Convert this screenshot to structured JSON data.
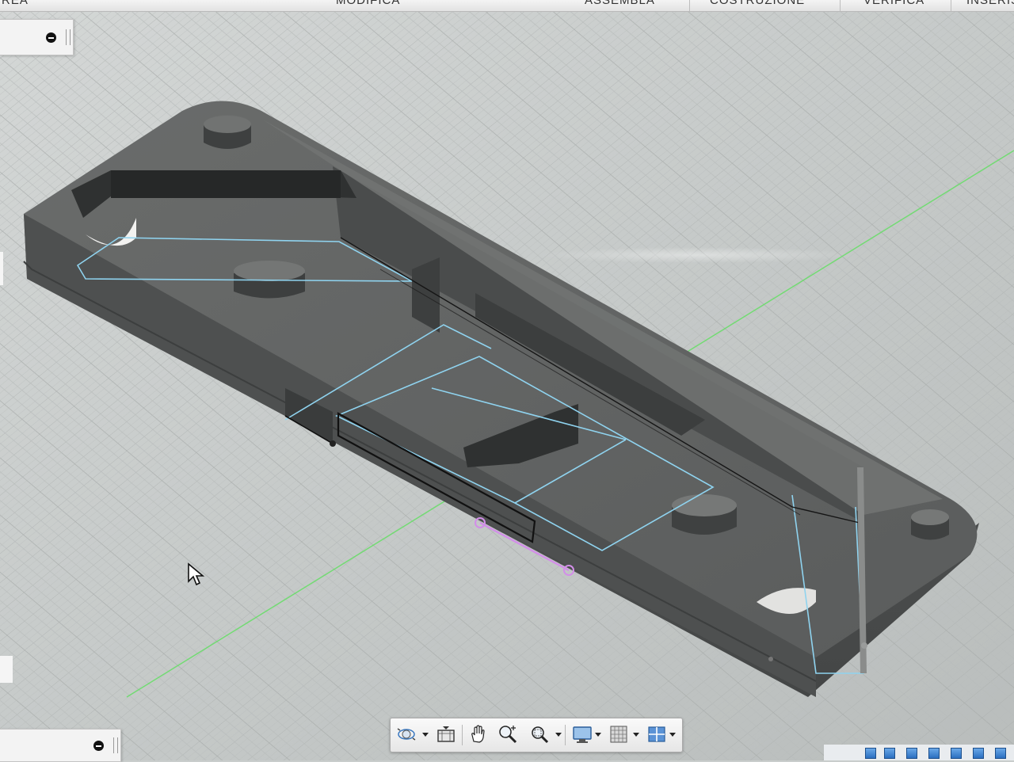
{
  "toolbar": {
    "tabs": [
      {
        "label": "REA"
      },
      {
        "label": "MODIFICA"
      },
      {
        "label": "ASSEMBLA"
      },
      {
        "label": "COSTRUZIONE"
      },
      {
        "label": "VERIFICA"
      },
      {
        "label": "INSERIS"
      }
    ]
  },
  "icons": {
    "browser_toggle": "minus-circle-icon",
    "comments_toggle": "minus-circle-icon",
    "orbit": "orbit-icon",
    "look_at": "look-at-icon",
    "pan": "pan-hand-icon",
    "zoom": "zoom-icon",
    "zoom_window": "zoom-window-icon",
    "display_settings": "display-settings-icon",
    "grid_settings": "grid-settings-icon",
    "viewports": "viewports-icon",
    "cursor": "arrow-cursor-icon"
  },
  "colors": {
    "body": "#5c5e5e",
    "body_top": "#6e706f",
    "body_side": "#4c4e4e",
    "sketch": "#8fd3ef",
    "selection": "#d28ee8",
    "axis_green": "#5fe05f",
    "grid": "#b4b8b7",
    "timeline": "#2b6fc0"
  }
}
